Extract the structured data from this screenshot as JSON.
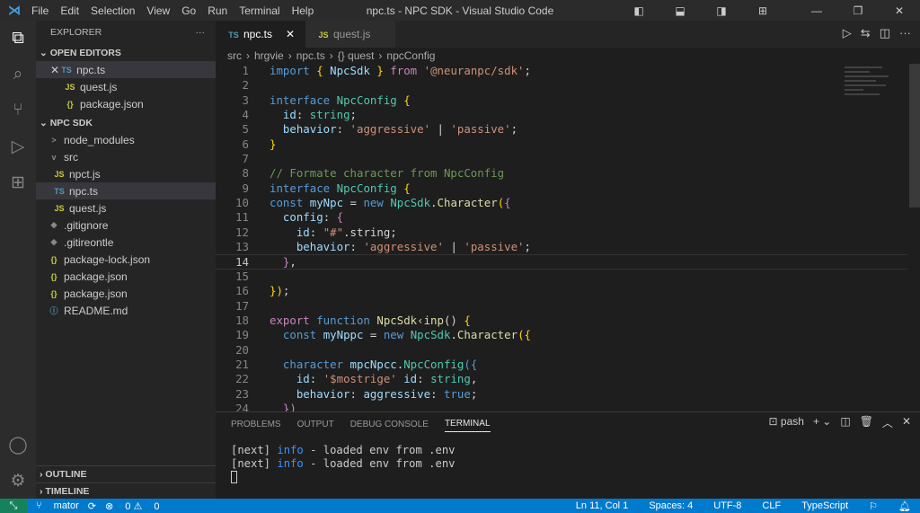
{
  "titlebar": {
    "menu": [
      "File",
      "Edit",
      "Selection",
      "View",
      "Go",
      "Run",
      "Terminal",
      "Help"
    ],
    "title": "npc.ts - NPC SDK - Visual Studio Code"
  },
  "sidebar": {
    "header": "EXPLORER",
    "open_editors": "OPEN EDITORS",
    "open_items": [
      {
        "badge": "TS",
        "name": "npc.ts",
        "type": "ts"
      },
      {
        "badge": "JS",
        "name": "quest.js",
        "type": "js"
      },
      {
        "badge": "{}",
        "name": "package.json",
        "type": "json"
      }
    ],
    "project": "NPC SDK",
    "tree": [
      {
        "name": "node_modules",
        "badge": ">",
        "type": "git",
        "indent": 1
      },
      {
        "name": "src",
        "badge": "v",
        "type": "git",
        "indent": 1
      },
      {
        "name": "npct.js",
        "badge": "JS",
        "type": "js",
        "indent": 2
      },
      {
        "name": "npc.ts",
        "badge": "TS",
        "type": "ts",
        "indent": 2,
        "selected": true
      },
      {
        "name": "quest.js",
        "badge": "JS",
        "type": "js",
        "indent": 2
      },
      {
        "name": ".gitignore",
        "badge": "◆",
        "type": "git",
        "indent": 1
      },
      {
        "name": ".gitireontle",
        "badge": "◆",
        "type": "git",
        "indent": 1
      },
      {
        "name": "package-lock.json",
        "badge": "{}",
        "type": "json",
        "indent": 1
      },
      {
        "name": "package.json",
        "badge": "{}",
        "type": "json",
        "indent": 1
      },
      {
        "name": "package.json",
        "badge": "{}",
        "type": "json",
        "indent": 1
      },
      {
        "name": "README.md",
        "badge": "ⓘ",
        "type": "md",
        "indent": 1
      }
    ],
    "outline": "OUTLINE",
    "timeline": "TIMELINE"
  },
  "tabs": [
    {
      "badge": "TS",
      "label": "npc.ts",
      "active": true
    },
    {
      "badge": "JS",
      "label": "quest.js",
      "active": false
    }
  ],
  "breadcrumb": [
    "src",
    "hrgvie",
    "npc.ts",
    "{} quest",
    "npcConfig"
  ],
  "code": [
    [
      [
        "import ",
        "k"
      ],
      [
        "{ ",
        "b"
      ],
      [
        "NpcSdk",
        "v"
      ],
      [
        " } ",
        "b"
      ],
      [
        "from ",
        "kw"
      ],
      [
        "'@neuranpc/sdk'",
        "s"
      ],
      [
        ";",
        "p"
      ]
    ],
    [],
    [
      [
        "interface ",
        "k"
      ],
      [
        "NpcConfig ",
        "t"
      ],
      [
        "{",
        "b"
      ]
    ],
    [
      [
        "  id",
        "v"
      ],
      [
        ": ",
        "p"
      ],
      [
        "string",
        "t"
      ],
      [
        ";",
        "p"
      ]
    ],
    [
      [
        "  behavior",
        "v"
      ],
      [
        ": ",
        "p"
      ],
      [
        "'aggressive'",
        "s"
      ],
      [
        " | ",
        "p"
      ],
      [
        "'passive'",
        "s"
      ],
      [
        ";",
        "p"
      ]
    ],
    [
      [
        "}",
        "b"
      ]
    ],
    [],
    [
      [
        "// Formate character from NpcConfig",
        "c"
      ]
    ],
    [
      [
        "interface ",
        "k"
      ],
      [
        "NpcConfig ",
        "t"
      ],
      [
        "{",
        "b"
      ]
    ],
    [
      [
        "const ",
        "k"
      ],
      [
        "myNpc",
        "v"
      ],
      [
        " = ",
        "p"
      ],
      [
        "new ",
        "k"
      ],
      [
        "NpcSdk",
        "t"
      ],
      [
        ".",
        "p"
      ],
      [
        "Character",
        "f"
      ],
      [
        "(",
        "b"
      ],
      [
        "{",
        "kw"
      ]
    ],
    [
      [
        "  config",
        "v"
      ],
      [
        ": ",
        "p"
      ],
      [
        "{",
        "kw"
      ]
    ],
    [
      [
        "    id",
        "v"
      ],
      [
        ": ",
        "p"
      ],
      [
        "\"#\"",
        "s"
      ],
      [
        ".string;",
        "p"
      ]
    ],
    [
      [
        "    behavior",
        "v"
      ],
      [
        ": ",
        "p"
      ],
      [
        "'aggressive'",
        "s"
      ],
      [
        " | ",
        "p"
      ],
      [
        "'passive'",
        "s"
      ],
      [
        ";",
        "p"
      ]
    ],
    [
      [
        "  }",
        "kw"
      ],
      [
        ",",
        "p"
      ]
    ],
    [],
    [
      [
        "})",
        "b"
      ],
      [
        ";",
        "p"
      ]
    ],
    [],
    [
      [
        "export ",
        "kw"
      ],
      [
        "function ",
        "k"
      ],
      [
        "NpcSdk",
        "f"
      ],
      [
        "‹inp",
        "f"
      ],
      [
        "() ",
        "p"
      ],
      [
        "{",
        "b"
      ]
    ],
    [
      [
        "  const ",
        "k"
      ],
      [
        "myNppc",
        "v"
      ],
      [
        " = ",
        "p"
      ],
      [
        "new ",
        "k"
      ],
      [
        "NpcSdk",
        "t"
      ],
      [
        ".",
        "p"
      ],
      [
        "Character",
        "f"
      ],
      [
        "({",
        "b"
      ]
    ],
    [],
    [
      [
        "  character ",
        "k"
      ],
      [
        "mpcNpcc",
        "v"
      ],
      [
        ".",
        "p"
      ],
      [
        "NpcConfig",
        "t"
      ],
      [
        "({",
        "k"
      ]
    ],
    [
      [
        "    id",
        "v"
      ],
      [
        ": ",
        "p"
      ],
      [
        "'$mostrige'",
        "s"
      ],
      [
        " id",
        "v"
      ],
      [
        ": ",
        "p"
      ],
      [
        "string",
        "t"
      ],
      [
        ",",
        "p"
      ]
    ],
    [
      [
        "    behavior",
        "v"
      ],
      [
        ": ",
        "p"
      ],
      [
        "aggressive",
        "v"
      ],
      [
        ": ",
        "p"
      ],
      [
        "true",
        "k"
      ],
      [
        ";",
        "p"
      ]
    ],
    [
      [
        "  })",
        "kw"
      ]
    ]
  ],
  "cursor_line": 14,
  "panel": {
    "tabs": [
      "PROBLEMS",
      "OUTPUT",
      "DEBUG CONSOLE",
      "TERMINAL"
    ],
    "active": "TERMINAL",
    "shell": "pash",
    "lines": [
      {
        "prefix": "[next] ",
        "level": "info",
        "msg": " - loaded env from .env"
      },
      {
        "prefix": "[next] ",
        "level": "info",
        "msg": " - loaded env from .env"
      }
    ]
  },
  "status": {
    "branch": "mator",
    "errors": "0",
    "warnings": "0",
    "position": "Ln 11, Col 1",
    "spaces": "Spaces: 4",
    "encoding": "UTF-8",
    "eol": "CLF",
    "language": "TypeScript"
  }
}
